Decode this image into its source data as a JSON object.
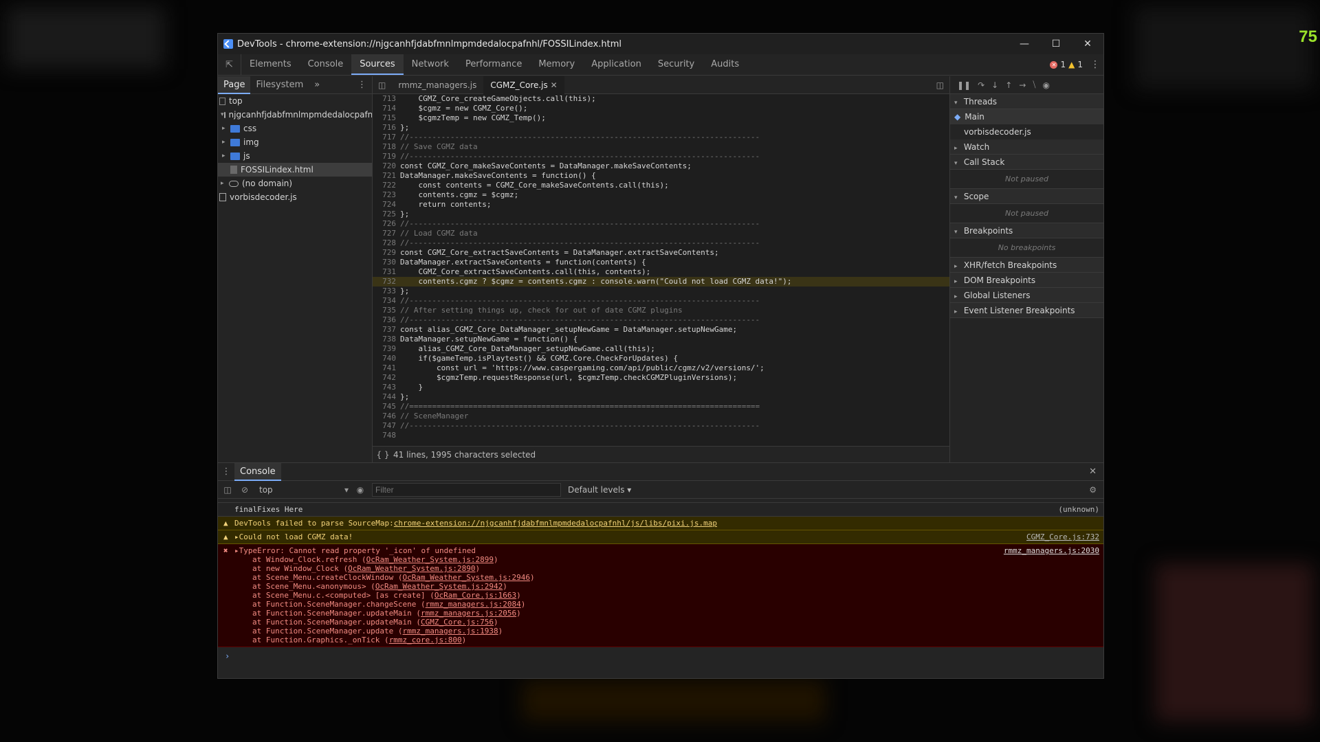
{
  "fps": "75",
  "window": {
    "title": "DevTools - chrome-extension://njgcanhfjdabfmnlmpmdedalocpafnhl/FOSSILindex.html"
  },
  "tabs": [
    "Elements",
    "Console",
    "Sources",
    "Network",
    "Performance",
    "Memory",
    "Application",
    "Security",
    "Audits"
  ],
  "active_tab": "Sources",
  "counts": {
    "errors": "1",
    "warnings": "1"
  },
  "navigator": {
    "tabs": [
      "Page",
      "Filesystem"
    ],
    "tree": [
      "top",
      "njgcanhfjdabfmnlmpmdedalocpafnhl",
      "css",
      "img",
      "js",
      "FOSSILindex.html",
      "(no domain)",
      "vorbisdecoder.js"
    ]
  },
  "editor": {
    "tabs": [
      "rmmz_managers.js",
      "CGMZ_Core.js"
    ],
    "lines": [
      {
        "n": "713",
        "t": "    CGMZ_Core_createGameObjects.call(this);"
      },
      {
        "n": "714",
        "t": "    $cgmz = new CGMZ_Core();"
      },
      {
        "n": "715",
        "t": "    $cgmzTemp = new CGMZ_Temp();"
      },
      {
        "n": "716",
        "t": "};"
      },
      {
        "n": "717",
        "t": "//-----------------------------------------------------------------------------"
      },
      {
        "n": "718",
        "t": "// Save CGMZ data"
      },
      {
        "n": "719",
        "t": "//-----------------------------------------------------------------------------"
      },
      {
        "n": "720",
        "t": "const CGMZ_Core_makeSaveContents = DataManager.makeSaveContents;"
      },
      {
        "n": "721",
        "t": "DataManager.makeSaveContents = function() {"
      },
      {
        "n": "722",
        "t": "    const contents = CGMZ_Core_makeSaveContents.call(this);"
      },
      {
        "n": "723",
        "t": "    contents.cgmz = $cgmz;"
      },
      {
        "n": "724",
        "t": "    return contents;"
      },
      {
        "n": "725",
        "t": "};"
      },
      {
        "n": "726",
        "t": "//-----------------------------------------------------------------------------"
      },
      {
        "n": "727",
        "t": "// Load CGMZ data"
      },
      {
        "n": "728",
        "t": "//-----------------------------------------------------------------------------"
      },
      {
        "n": "729",
        "t": "const CGMZ_Core_extractSaveContents = DataManager.extractSaveContents;"
      },
      {
        "n": "730",
        "t": "DataManager.extractSaveContents = function(contents) {"
      },
      {
        "n": "731",
        "t": "    CGMZ_Core_extractSaveContents.call(this, contents);"
      },
      {
        "n": "732",
        "t": "    contents.cgmz ? $cgmz = contents.cgmz : console.warn(\"Could not load CGMZ data!\");"
      },
      {
        "n": "733",
        "t": "};"
      },
      {
        "n": "734",
        "t": "//-----------------------------------------------------------------------------"
      },
      {
        "n": "735",
        "t": "// After setting things up, check for out of date CGMZ plugins"
      },
      {
        "n": "736",
        "t": "//-----------------------------------------------------------------------------"
      },
      {
        "n": "737",
        "t": "const alias_CGMZ_Core_DataManager_setupNewGame = DataManager.setupNewGame;"
      },
      {
        "n": "738",
        "t": "DataManager.setupNewGame = function() {"
      },
      {
        "n": "739",
        "t": "    alias_CGMZ_Core_DataManager_setupNewGame.call(this);"
      },
      {
        "n": "740",
        "t": "    if($gameTemp.isPlaytest() && CGMZ.Core.CheckForUpdates) {"
      },
      {
        "n": "741",
        "t": "        const url = 'https://www.caspergaming.com/api/public/cgmz/v2/versions/';"
      },
      {
        "n": "742",
        "t": "        $cgmzTemp.requestResponse(url, $cgmzTemp.checkCGMZPluginVersions);"
      },
      {
        "n": "743",
        "t": "    }"
      },
      {
        "n": "744",
        "t": "};"
      },
      {
        "n": "745",
        "t": "//============================================================================="
      },
      {
        "n": "746",
        "t": "// SceneManager"
      },
      {
        "n": "747",
        "t": "//-----------------------------------------------------------------------------"
      },
      {
        "n": "748",
        "t": ""
      }
    ],
    "status": "41 lines, 1995 characters selected"
  },
  "debugger": {
    "threads_label": "Threads",
    "threads": [
      "Main",
      "vorbisdecoder.js"
    ],
    "watch": "Watch",
    "call_stack": "Call Stack",
    "not_paused": "Not paused",
    "scope": "Scope",
    "breakpoints": "Breakpoints",
    "no_breakpoints": "No breakpoints",
    "xhr": "XHR/fetch Breakpoints",
    "dom": "DOM Breakpoints",
    "global": "Global Listeners",
    "event": "Event Listener Breakpoints"
  },
  "console": {
    "tab": "Console",
    "context": "top",
    "filter_placeholder": "Filter",
    "levels": "Default levels",
    "msg_final": "finalFixes Here",
    "msg_final_src": "(unknown)",
    "msg_sourcemap": "DevTools failed to parse SourceMap: ",
    "msg_sourcemap_link": "chrome-extension://njgcanhfjdabfmnlmpmdedalocpafnhl/js/libs/pixi.js.map",
    "msg_cgmz": "Could not load CGMZ data!",
    "msg_cgmz_src": "CGMZ_Core.js:732",
    "msg_error": "TypeError: Cannot read property '_icon' of undefined",
    "msg_error_src": "rmmz_managers.js:2030",
    "stack": [
      {
        "fn": "at Window_Clock.refresh (",
        "loc": "OcRam_Weather_System.js:2899",
        "end": ")"
      },
      {
        "fn": "at new Window_Clock (",
        "loc": "OcRam_Weather_System.js:2890",
        "end": ")"
      },
      {
        "fn": "at Scene_Menu.createClockWindow (",
        "loc": "OcRam_Weather_System.js:2946",
        "end": ")"
      },
      {
        "fn": "at Scene_Menu.<anonymous> (",
        "loc": "OcRam_Weather_System.js:2942",
        "end": ")"
      },
      {
        "fn": "at Scene_Menu.c.<computed> [as create] (",
        "loc": "OcRam_Core.js:1663",
        "end": ")"
      },
      {
        "fn": "at Function.SceneManager.changeScene (",
        "loc": "rmmz_managers.js:2084",
        "end": ")"
      },
      {
        "fn": "at Function.SceneManager.updateMain (",
        "loc": "rmmz_managers.js:2056",
        "end": ")"
      },
      {
        "fn": "at Function.SceneManager.updateMain (",
        "loc": "CGMZ_Core.js:756",
        "end": ")"
      },
      {
        "fn": "at Function.SceneManager.update (",
        "loc": "rmmz_managers.js:1938",
        "end": ")"
      },
      {
        "fn": "at Function.Graphics._onTick (",
        "loc": "rmmz_core.js:800",
        "end": ")"
      }
    ]
  }
}
